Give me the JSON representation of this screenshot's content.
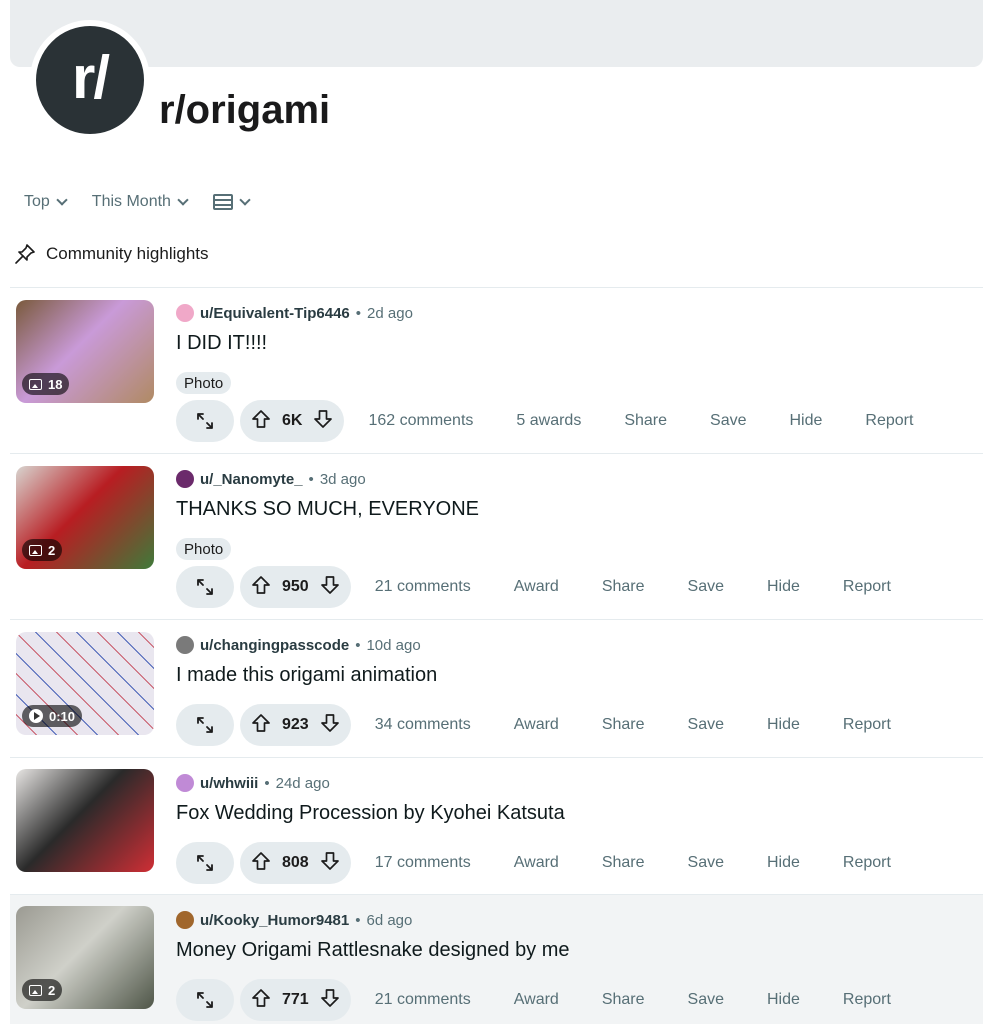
{
  "subreddit": {
    "avatar_text": "r/",
    "name": "r/origami"
  },
  "sort": {
    "primary": "Top",
    "range": "This Month"
  },
  "highlights_label": "Community highlights",
  "posts": [
    {
      "user": "u/Equivalent-Tip6446",
      "ago": "2d ago",
      "title": "I DID IT!!!!",
      "flair": "Photo",
      "badge": "18",
      "badge_type": "gallery",
      "votes": "6K",
      "comments": "162 comments",
      "award": "5 awards",
      "share": "Share",
      "save": "Save",
      "hide": "Hide",
      "report": "Report",
      "thumb_colors": [
        "#7a5a3c",
        "#b08a63",
        "#c99ad8"
      ],
      "avatar_color": "#f0a8c8"
    },
    {
      "user": "u/_Nanomyte_",
      "ago": "3d ago",
      "title": "THANKS SO MUCH, EVERYONE",
      "flair": "Photo",
      "badge": "2",
      "badge_type": "gallery",
      "votes": "950",
      "comments": "21 comments",
      "award": "Award",
      "share": "Share",
      "save": "Save",
      "hide": "Hide",
      "report": "Report",
      "thumb_colors": [
        "#d8d4cf",
        "#3f7a3a",
        "#b81d22"
      ],
      "avatar_color": "#6b2a6b"
    },
    {
      "user": "u/changingpasscode",
      "ago": "10d ago",
      "title": "I made this origami animation",
      "flair": "",
      "badge": "0:10",
      "badge_type": "video",
      "votes": "923",
      "comments": "34 comments",
      "award": "Award",
      "share": "Share",
      "save": "Save",
      "hide": "Hide",
      "report": "Report",
      "thumb_colors": [
        "#e9e6ef",
        "#c95b6b",
        "#4a63b8"
      ],
      "avatar_color": "#7a7a7a"
    },
    {
      "user": "u/whwiii",
      "ago": "24d ago",
      "title": "Fox Wedding Procession by Kyohei Katsuta",
      "flair": "",
      "badge": "",
      "badge_type": "none",
      "votes": "808",
      "comments": "17 comments",
      "award": "Award",
      "share": "Share",
      "save": "Save",
      "hide": "Hide",
      "report": "Report",
      "thumb_colors": [
        "#e7e5e3",
        "#cf2e35",
        "#2a2a2a"
      ],
      "avatar_color": "#c08ad6"
    },
    {
      "user": "u/Kooky_Humor9481",
      "ago": "6d ago",
      "title": "Money Origami Rattlesnake designed by me",
      "flair": "",
      "badge": "2",
      "badge_type": "gallery",
      "votes": "771",
      "comments": "21 comments",
      "award": "Award",
      "share": "Share",
      "save": "Save",
      "hide": "Hide",
      "report": "Report",
      "thumb_colors": [
        "#9b9a92",
        "#4f5648",
        "#cfd0c9"
      ],
      "avatar_color": "#a0662c"
    }
  ]
}
